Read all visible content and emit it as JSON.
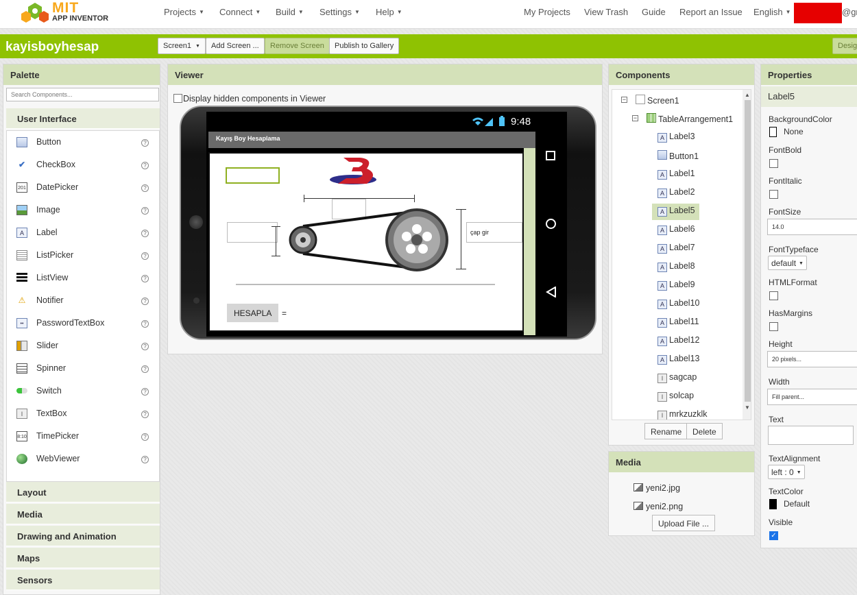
{
  "brand": {
    "mit": "MIT",
    "subtitle": "APP INVENTOR"
  },
  "top_menu": [
    {
      "label": "Projects",
      "icon": "chevron-down-icon"
    },
    {
      "label": "Connect",
      "icon": "chevron-down-icon"
    },
    {
      "label": "Build",
      "icon": "chevron-down-icon"
    },
    {
      "label": "Settings",
      "icon": "chevron-down-icon"
    },
    {
      "label": "Help",
      "icon": "chevron-down-icon"
    }
  ],
  "top_links": [
    "My Projects",
    "View Trash",
    "Guide",
    "Report an Issue",
    "English"
  ],
  "user_email_fragment": "@gr",
  "project": {
    "name": "kayisboyhesap",
    "screen_select": "Screen1",
    "add_screen": "Add Screen ...",
    "remove_screen": "Remove Screen",
    "publish": "Publish to Gallery",
    "designer": "Desig"
  },
  "palette": {
    "title": "Palette",
    "search_placeholder": "Search Components...",
    "active_category": "User Interface",
    "items": [
      {
        "label": "Button",
        "icon": "button-icon"
      },
      {
        "label": "CheckBox",
        "icon": "checkbox-icon"
      },
      {
        "label": "DatePicker",
        "icon": "datepicker-icon"
      },
      {
        "label": "Image",
        "icon": "image-icon"
      },
      {
        "label": "Label",
        "icon": "label-icon"
      },
      {
        "label": "ListPicker",
        "icon": "listpicker-icon"
      },
      {
        "label": "ListView",
        "icon": "listview-icon"
      },
      {
        "label": "Notifier",
        "icon": "notifier-icon"
      },
      {
        "label": "PasswordTextBox",
        "icon": "passwordtextbox-icon"
      },
      {
        "label": "Slider",
        "icon": "slider-icon"
      },
      {
        "label": "Spinner",
        "icon": "spinner-icon"
      },
      {
        "label": "Switch",
        "icon": "switch-icon"
      },
      {
        "label": "TextBox",
        "icon": "textbox-icon"
      },
      {
        "label": "TimePicker",
        "icon": "timepicker-icon"
      },
      {
        "label": "WebViewer",
        "icon": "webviewer-icon"
      }
    ],
    "help_glyph": "?",
    "categories": [
      "Layout",
      "Media",
      "Drawing and Animation",
      "Maps",
      "Sensors"
    ]
  },
  "viewer": {
    "title": "Viewer",
    "hidden_label": "Display hidden components in Viewer",
    "status_time": "9:48",
    "app_title": "Kayış Boy Hesaplama",
    "button_text": "HESAPLA",
    "equals": "=",
    "cap_hint": "çap gir"
  },
  "components": {
    "title": "Components",
    "tree": [
      {
        "label": "Screen1",
        "depth": 0,
        "toggle": "−",
        "icon": "screen-icon"
      },
      {
        "label": "TableArrangement1",
        "depth": 1,
        "toggle": "−",
        "icon": "table-arrangement-icon"
      },
      {
        "label": "Label3",
        "depth": 2,
        "icon": "label-icon"
      },
      {
        "label": "Button1",
        "depth": 2,
        "icon": "button-icon"
      },
      {
        "label": "Label1",
        "depth": 2,
        "icon": "label-icon"
      },
      {
        "label": "Label2",
        "depth": 2,
        "icon": "label-icon"
      },
      {
        "label": "Label5",
        "depth": 2,
        "icon": "label-icon",
        "selected": true
      },
      {
        "label": "Label6",
        "depth": 2,
        "icon": "label-icon"
      },
      {
        "label": "Label7",
        "depth": 2,
        "icon": "label-icon"
      },
      {
        "label": "Label8",
        "depth": 2,
        "icon": "label-icon"
      },
      {
        "label": "Label9",
        "depth": 2,
        "icon": "label-icon"
      },
      {
        "label": "Label10",
        "depth": 2,
        "icon": "label-icon"
      },
      {
        "label": "Label11",
        "depth": 2,
        "icon": "label-icon"
      },
      {
        "label": "Label12",
        "depth": 2,
        "icon": "label-icon"
      },
      {
        "label": "Label13",
        "depth": 2,
        "icon": "label-icon"
      },
      {
        "label": "sagcap",
        "depth": 2,
        "icon": "textbox-icon"
      },
      {
        "label": "solcap",
        "depth": 2,
        "icon": "textbox-icon"
      },
      {
        "label": "mrkzuzklk",
        "depth": 2,
        "icon": "textbox-icon"
      }
    ],
    "rename": "Rename",
    "delete": "Delete"
  },
  "media": {
    "title": "Media",
    "files": [
      "yeni2.jpg",
      "yeni2.png"
    ],
    "upload": "Upload File ..."
  },
  "properties": {
    "title": "Properties",
    "component": "Label5",
    "background_color": {
      "label": "BackgroundColor",
      "value": "None",
      "color": "#ffffff"
    },
    "font_bold": {
      "label": "FontBold",
      "checked": false
    },
    "font_italic": {
      "label": "FontItalic",
      "checked": false
    },
    "font_size": {
      "label": "FontSize",
      "value": "14.0"
    },
    "font_typeface": {
      "label": "FontTypeface",
      "value": "default"
    },
    "html_format": {
      "label": "HTMLFormat",
      "checked": false
    },
    "has_margins": {
      "label": "HasMargins",
      "checked": false
    },
    "height": {
      "label": "Height",
      "value": "20 pixels..."
    },
    "width": {
      "label": "Width",
      "value": "Fill parent..."
    },
    "text": {
      "label": "Text",
      "value": ""
    },
    "text_alignment": {
      "label": "TextAlignment",
      "value": "left : 0"
    },
    "text_color": {
      "label": "TextColor",
      "value": "Default",
      "color": "#000000"
    },
    "visible": {
      "label": "Visible",
      "checked": true,
      "glyph": "✓"
    }
  },
  "colors": {
    "accent_green": "#8fc202",
    "panel_header": "#d4e1b9",
    "brand_orange": "#f8a81c"
  }
}
